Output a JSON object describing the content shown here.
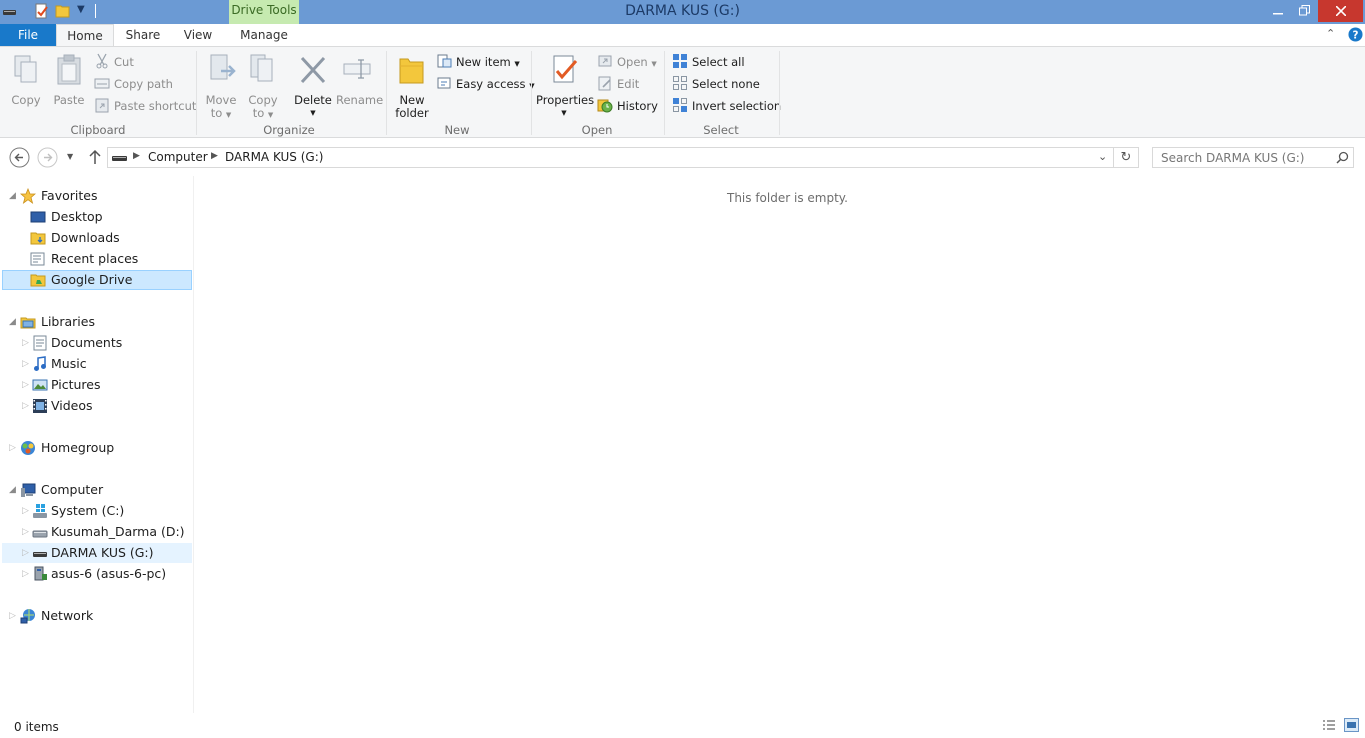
{
  "window": {
    "title": "DARMA KUS (G:)",
    "context_tab_group": "Drive Tools",
    "controls": {
      "minimize": "minimize-icon",
      "maximize": "restore-icon",
      "close": "close-icon"
    }
  },
  "tabs": {
    "file": "File",
    "home": "Home",
    "share": "Share",
    "view": "View",
    "manage": "Manage"
  },
  "ribbon": {
    "clipboard": {
      "label": "Clipboard",
      "copy": "Copy",
      "paste": "Paste",
      "cut": "Cut",
      "copy_path": "Copy path",
      "paste_shortcut": "Paste shortcut"
    },
    "organize": {
      "label": "Organize",
      "move_to": [
        "Move",
        "to"
      ],
      "copy_to": [
        "Copy",
        "to"
      ],
      "delete": "Delete",
      "rename": "Rename"
    },
    "new": {
      "label": "New",
      "new_folder": [
        "New",
        "folder"
      ],
      "new_item": "New item",
      "easy_access": "Easy access"
    },
    "open": {
      "label": "Open",
      "properties": "Properties",
      "open": "Open",
      "edit": "Edit",
      "history": "History"
    },
    "select": {
      "label": "Select",
      "select_all": "Select all",
      "select_none": "Select none",
      "invert_selection": "Invert selection"
    }
  },
  "address": {
    "breadcrumb": [
      "Computer",
      "DARMA KUS (G:)"
    ],
    "search_placeholder": "Search DARMA KUS (G:)"
  },
  "nav": {
    "favorites": {
      "label": "Favorites",
      "items": [
        "Desktop",
        "Downloads",
        "Recent places",
        "Google Drive"
      ]
    },
    "libraries": {
      "label": "Libraries",
      "items": [
        "Documents",
        "Music",
        "Pictures",
        "Videos"
      ]
    },
    "homegroup": "Homegroup",
    "computer": {
      "label": "Computer",
      "items": [
        "System (C:)",
        "Kusumah_Darma (D:)",
        "DARMA KUS (G:)",
        "asus-6 (asus-6-pc)"
      ]
    },
    "network": "Network"
  },
  "content": {
    "empty_message": "This folder is empty."
  },
  "status": {
    "items": "0 items"
  },
  "colors": {
    "titlebar": "#6b9ad4",
    "file_tab": "#1979ca",
    "context_tab": "#c6eab0",
    "close_button": "#c7372e",
    "selection": "#cce8ff"
  }
}
